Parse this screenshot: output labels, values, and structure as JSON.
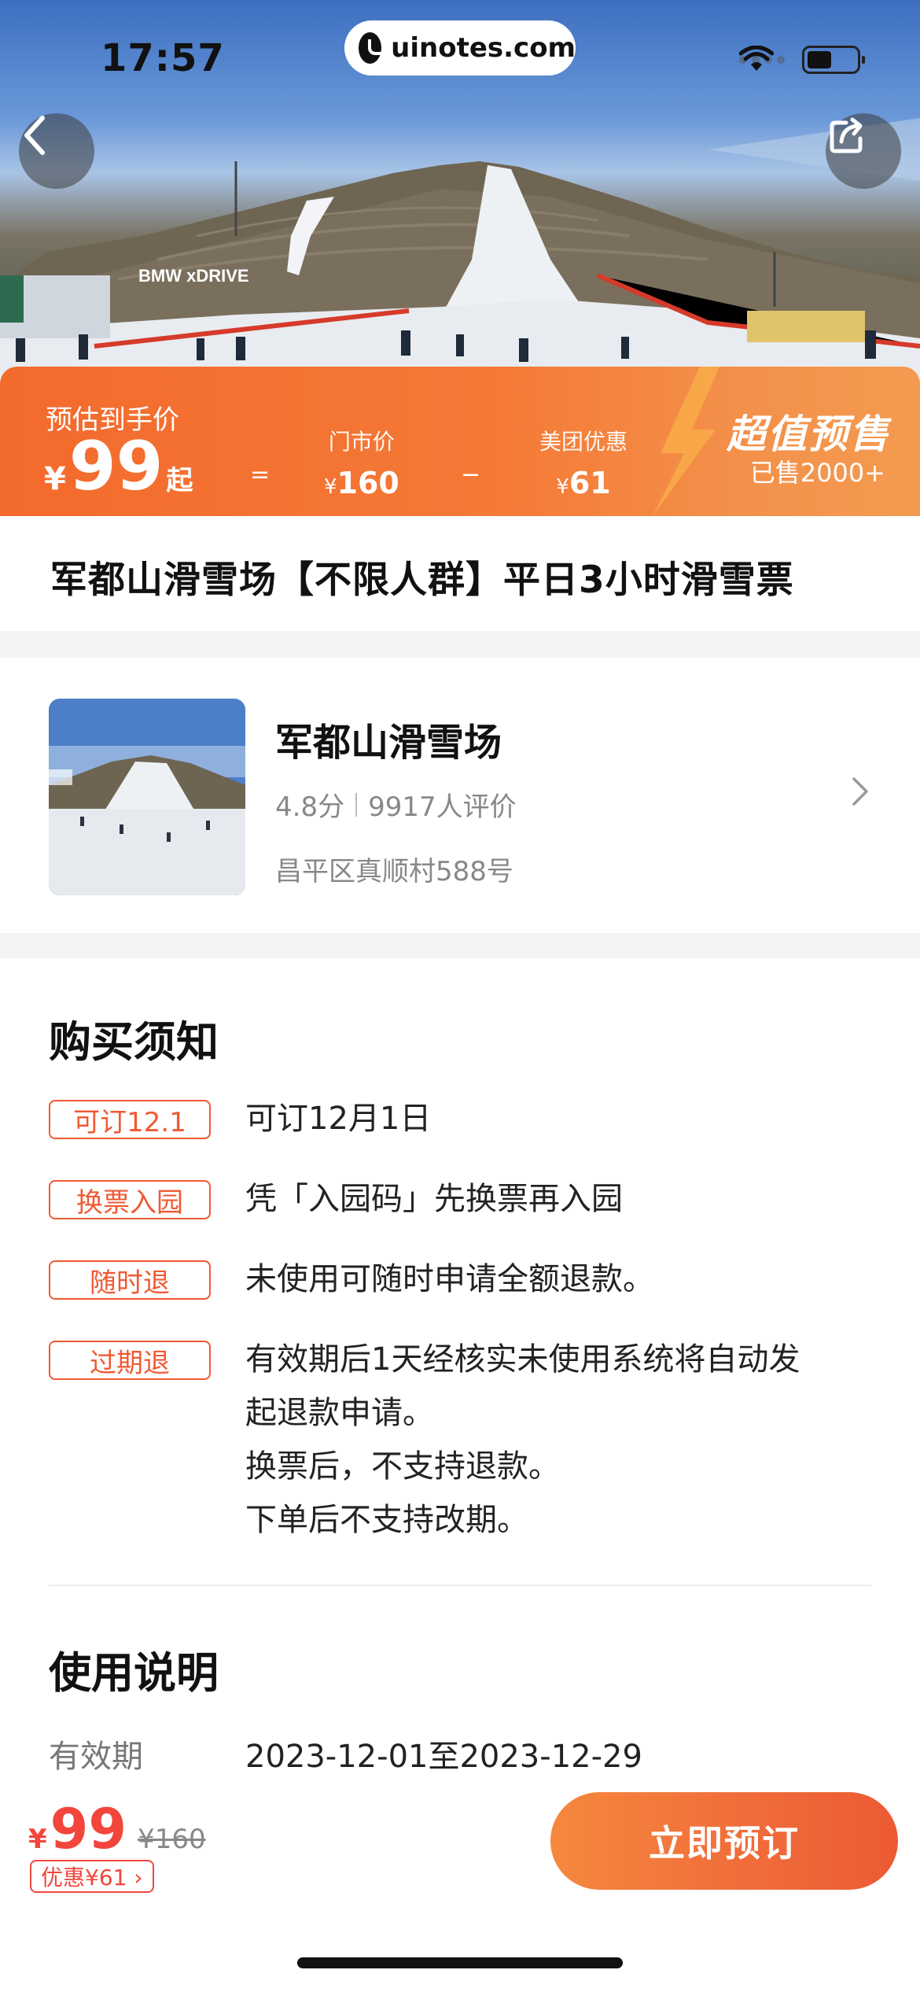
{
  "status_bar": {
    "time": "17:57",
    "url": "uinotes.com"
  },
  "hero": {
    "sign_text": "BMW xDRIVE"
  },
  "price_banner": {
    "estimate_label": "预估到手价",
    "currency": "¥",
    "estimate_price": "99",
    "estimate_suffix": "起",
    "equals": "=",
    "minus": "−",
    "market_label": "门市价",
    "market_price": "160",
    "discount_label": "美团优惠",
    "discount_price": "61",
    "promo_badge": "超值预售",
    "sold_count": "已售2000+",
    "colors": {
      "banner": "#f47a36",
      "accent": "#f05a33"
    }
  },
  "product": {
    "title": "军都山滑雪场【不限人群】平日3小时滑雪票"
  },
  "venue": {
    "name": "军都山滑雪场",
    "rating": "4.8分",
    "reviews": "9917人评价",
    "address": "昌平区真顺村588号"
  },
  "notice": {
    "title": "购买须知",
    "rules": [
      {
        "tag": "可订12.1",
        "lines": [
          "可订12月1日"
        ]
      },
      {
        "tag": "换票入园",
        "lines": [
          "凭「入园码」先换票再入园"
        ]
      },
      {
        "tag": "随时退",
        "lines": [
          "未使用可随时申请全额退款。"
        ]
      },
      {
        "tag": "过期退",
        "lines": [
          "有效期后1天经核实未使用系统将自动发",
          "起退款申请。",
          "换票后，不支持退款。",
          "下单后不支持改期。"
        ]
      }
    ]
  },
  "usage": {
    "title": "使用说明",
    "validity_label": "有效期",
    "validity_value": "2023-12-01至2023-12-29"
  },
  "bottom_bar": {
    "currency": "¥",
    "price": "99",
    "original_price": "¥160",
    "discount": "优惠¥61 ›",
    "book_button": "立即预订"
  }
}
